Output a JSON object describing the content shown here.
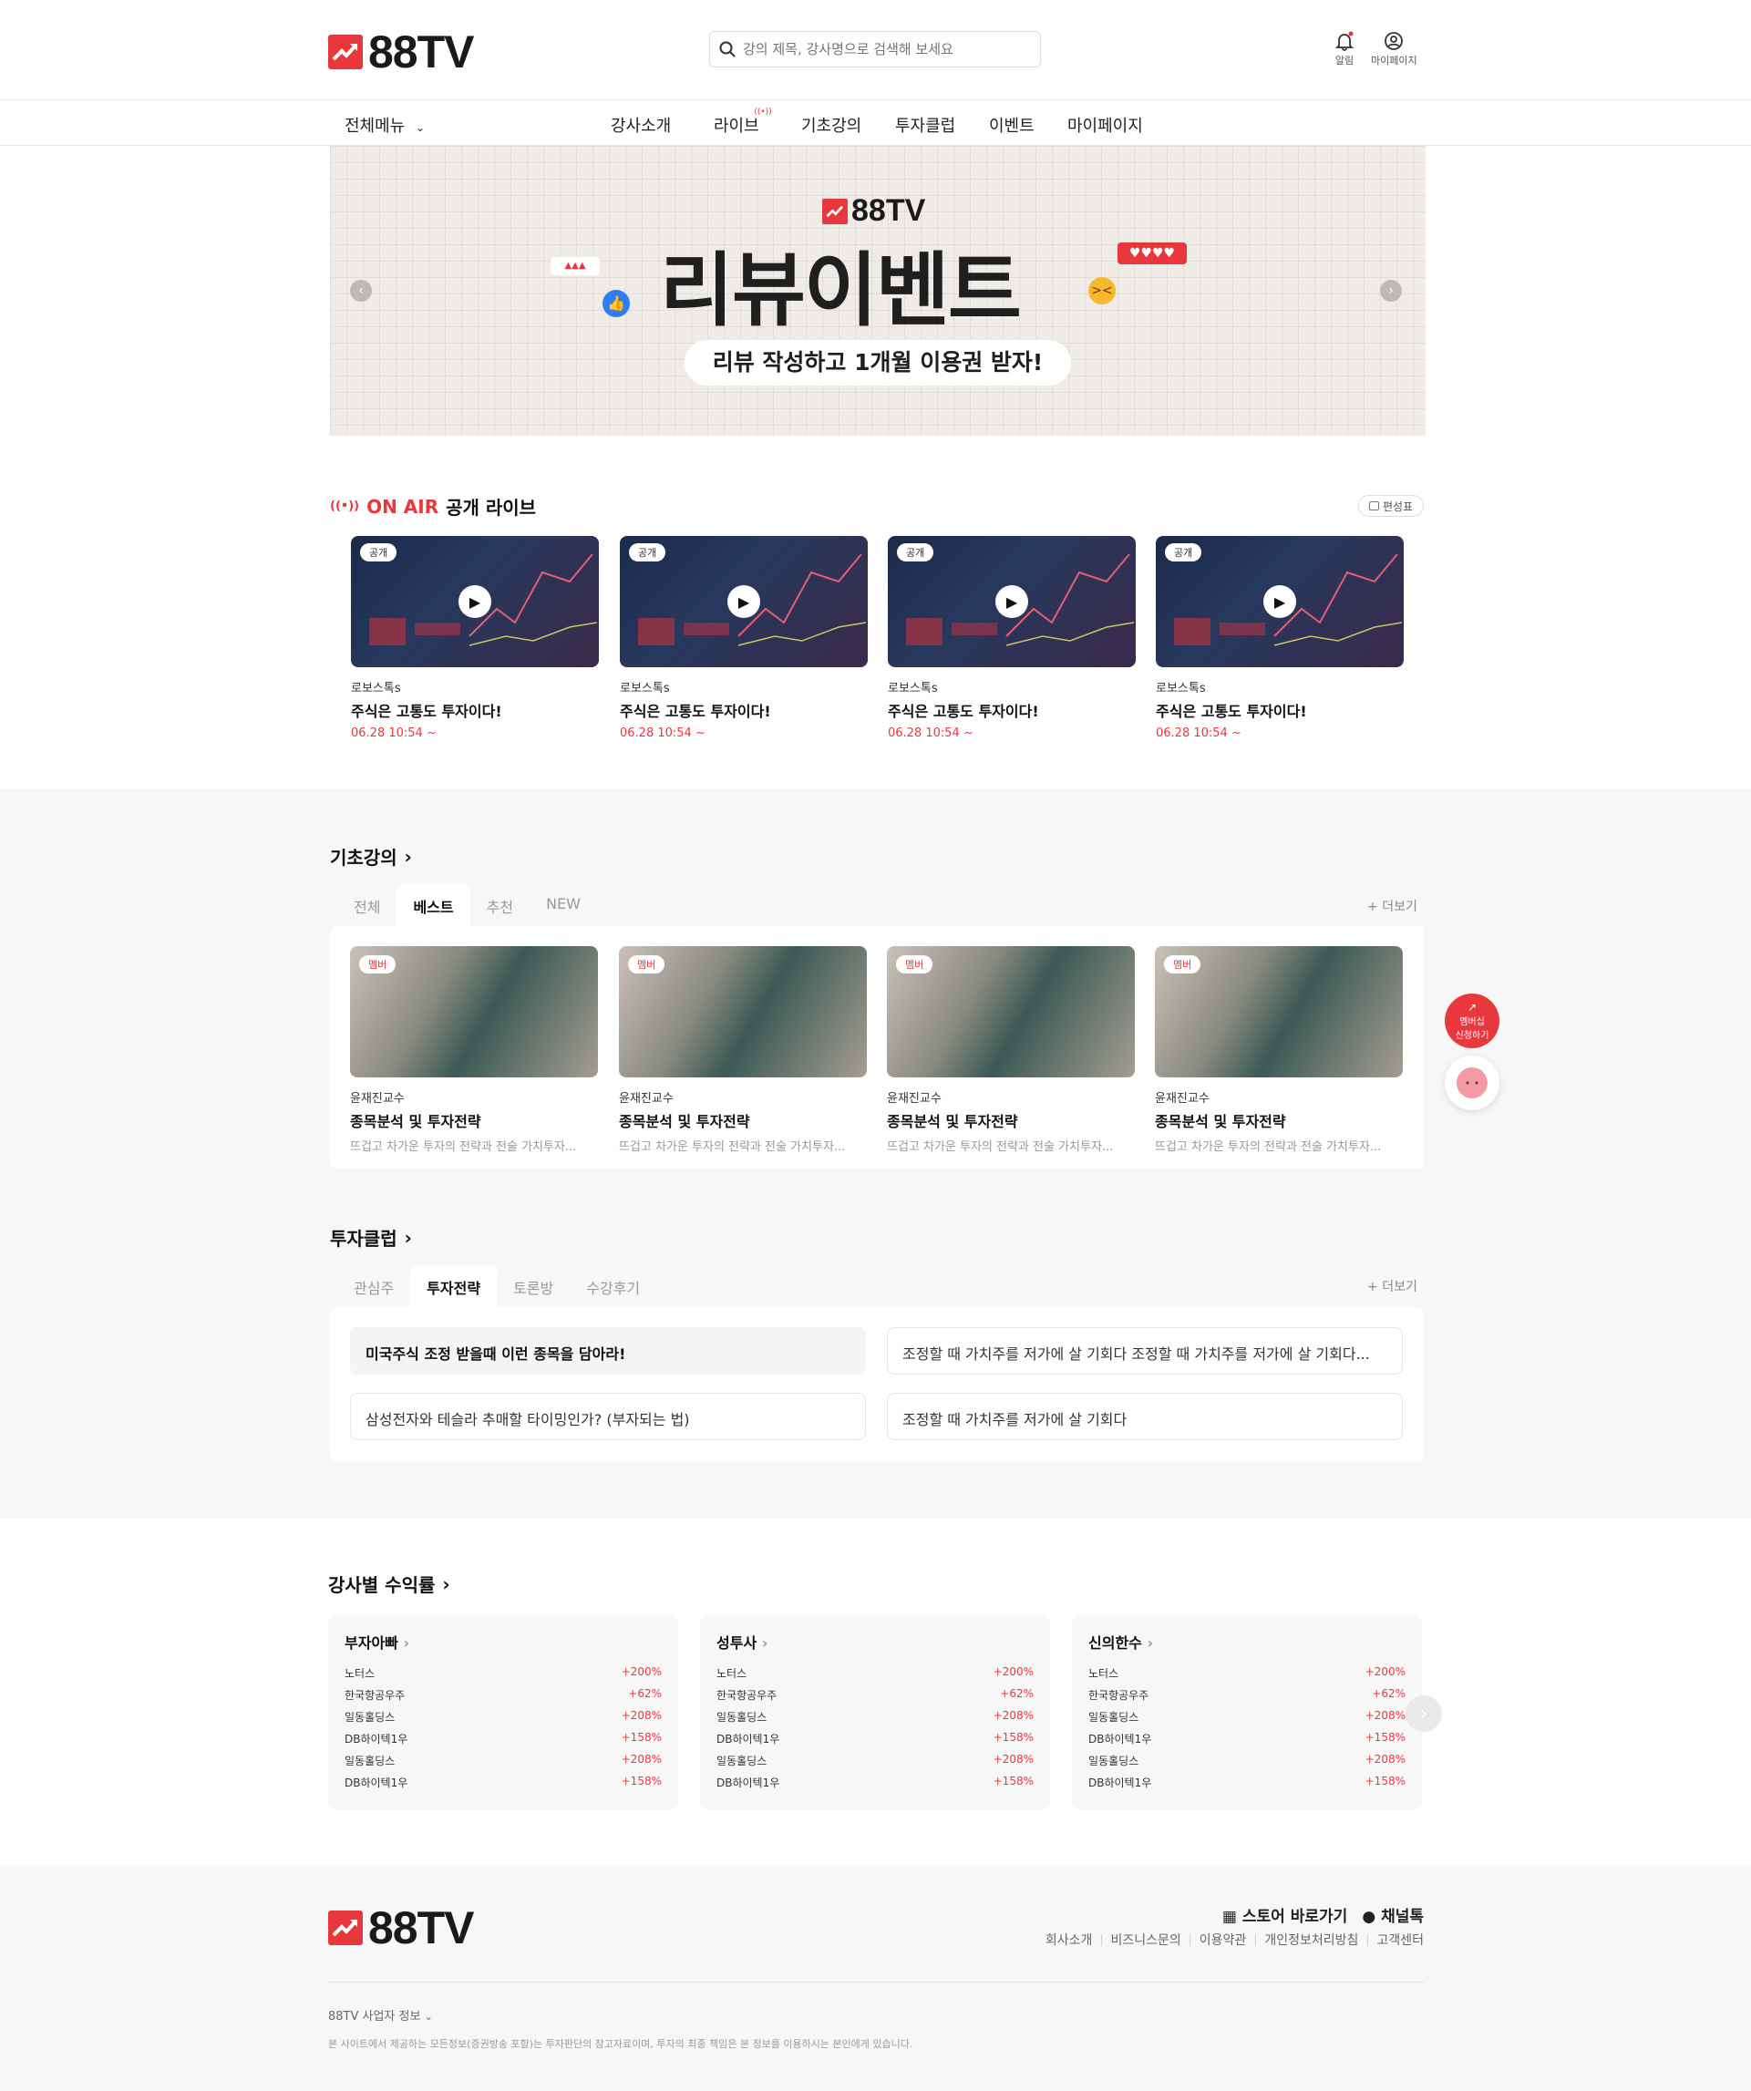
{
  "header": {
    "logo_text": "88TV",
    "search_placeholder": "강의 제목, 강사명으로 검색해 보세요",
    "alarm_label": "알림",
    "mypage_label": "마이페이지"
  },
  "nav": {
    "all_menu": "전체메뉴",
    "items": [
      "강사소개",
      "라이브",
      "기초강의",
      "투자클럽",
      "이벤트",
      "마이페이지"
    ]
  },
  "banner": {
    "logo_text": "88TV",
    "title": "리뷰이벤트",
    "subtitle": "리뷰 작성하고 1개월 이용권 받자!"
  },
  "live": {
    "on_air": "ON AIR",
    "title": "공개 라이브",
    "schedule_label": "편성표",
    "cards": [
      {
        "badge": "공개",
        "author": "로보스톡s",
        "title": "주식은 고통도 투자이다!",
        "time": "06.28 10:54 ~"
      },
      {
        "badge": "공개",
        "author": "로보스톡s",
        "title": "주식은 고통도 투자이다!",
        "time": "06.28 10:54 ~"
      },
      {
        "badge": "공개",
        "author": "로보스톡s",
        "title": "주식은 고통도 투자이다!",
        "time": "06.28 10:54 ~"
      },
      {
        "badge": "공개",
        "author": "로보스톡s",
        "title": "주식은 고통도 투자이다!",
        "time": "06.28 10:54 ~"
      }
    ]
  },
  "lectures": {
    "title": "기초강의",
    "tabs": [
      "전체",
      "베스트",
      "추천",
      "NEW"
    ],
    "active_tab": "베스트",
    "more": "더보기",
    "cards": [
      {
        "badge": "멤버",
        "author": "윤재진교수",
        "title": "종목분석 및 투자전략",
        "desc": "뜨겁고 차가운 투자의 전략과 전술 가치투자..."
      },
      {
        "badge": "멤버",
        "author": "윤재진교수",
        "title": "종목분석 및 투자전략",
        "desc": "뜨겁고 차가운 투자의 전략과 전술 가치투자..."
      },
      {
        "badge": "멤버",
        "author": "윤재진교수",
        "title": "종목분석 및 투자전략",
        "desc": "뜨겁고 차가운 투자의 전략과 전술 가치투자..."
      },
      {
        "badge": "멤버",
        "author": "윤재진교수",
        "title": "종목분석 및 투자전략",
        "desc": "뜨겁고 차가운 투자의 전략과 전술 가치투자..."
      }
    ]
  },
  "club": {
    "title": "투자클럽",
    "tabs": [
      "관심주",
      "투자전략",
      "토론방",
      "수강후기"
    ],
    "active_tab": "투자전략",
    "more": "더보기",
    "posts": [
      "미국주식 조정 받을때 이런 종목을 담아라!",
      "조정할 때 가치주를 저가에 살 기회다  조정할 때 가치주를 저가에 살 기회다...",
      "삼성전자와 테슬라 추매할 타이밍인가? (부자되는 법)",
      "조정할 때 가치주를 저가에 살 기회다"
    ]
  },
  "floating": {
    "membership_line1": "멤버십",
    "membership_line2": "신청하기"
  },
  "returns": {
    "title": "강사별 수익률",
    "cards": [
      {
        "name": "부자아빠",
        "rows": [
          {
            "stock": "노터스",
            "pct": "+200%"
          },
          {
            "stock": "한국항공우주",
            "pct": "+62%"
          },
          {
            "stock": "일동홀딩스",
            "pct": "+208%"
          },
          {
            "stock": "DB하이텍1우",
            "pct": "+158%"
          },
          {
            "stock": "일동홀딩스",
            "pct": "+208%"
          },
          {
            "stock": "DB하이텍1우",
            "pct": "+158%"
          }
        ]
      },
      {
        "name": "성투사",
        "rows": [
          {
            "stock": "노터스",
            "pct": "+200%"
          },
          {
            "stock": "한국항공우주",
            "pct": "+62%"
          },
          {
            "stock": "일동홀딩스",
            "pct": "+208%"
          },
          {
            "stock": "DB하이텍1우",
            "pct": "+158%"
          },
          {
            "stock": "일동홀딩스",
            "pct": "+208%"
          },
          {
            "stock": "DB하이텍1우",
            "pct": "+158%"
          }
        ]
      },
      {
        "name": "신의한수",
        "rows": [
          {
            "stock": "노터스",
            "pct": "+200%"
          },
          {
            "stock": "한국항공우주",
            "pct": "+62%"
          },
          {
            "stock": "일동홀딩스",
            "pct": "+208%"
          },
          {
            "stock": "DB하이텍1우",
            "pct": "+158%"
          },
          {
            "stock": "일동홀딩스",
            "pct": "+208%"
          },
          {
            "stock": "DB하이텍1우",
            "pct": "+158%"
          }
        ]
      }
    ]
  },
  "footer": {
    "logo_text": "88TV",
    "store_label": "스토어 바로가기",
    "channel_label": "채널톡",
    "links": [
      "회사소개",
      "비즈니스문의",
      "이용약관",
      "개인정보처리방침",
      "고객센터"
    ],
    "biz_info": "88TV 사업자 정보",
    "disclaimer": "본 사이트에서 제공하는 모든정보(증권방송 포함)는 투자판단의 참고자료이며, 투자의 최종 책임은 본 정보를 이용하시는 본인에게 있습니다."
  },
  "colors": {
    "accent": "#e8383d",
    "band": "#f7f7f7",
    "like_blue": "#2f7df6"
  },
  "icons": [
    "search-icon",
    "bell-icon",
    "user-icon",
    "chevron-down-icon",
    "broadcast-icon",
    "calendar-icon",
    "play-icon",
    "chevron-right-icon",
    "plus-icon",
    "chart-icon",
    "chat-bot-icon",
    "store-icon",
    "chat-icon"
  ]
}
